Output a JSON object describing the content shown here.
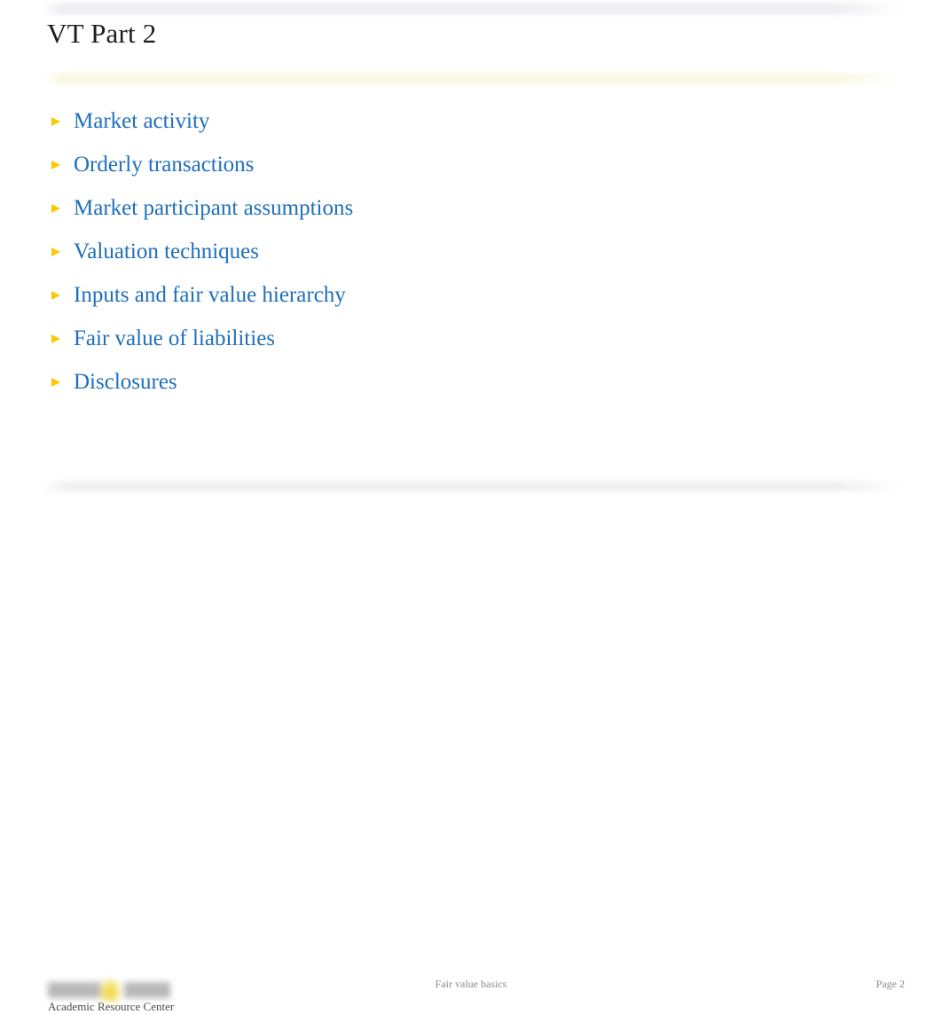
{
  "slide": {
    "title": "VT Part 2",
    "bullets": [
      {
        "marker": "triangle-right-bullet-icon",
        "label": "Market activity"
      },
      {
        "marker": "triangle-right-bullet-icon",
        "label": "Orderly transactions"
      },
      {
        "marker": "triangle-right-bullet-icon",
        "label": "Market participant assumptions"
      },
      {
        "marker": "triangle-right-bullet-icon",
        "label": "Valuation techniques"
      },
      {
        "marker": "triangle-right-bullet-icon",
        "label": "Inputs and fair value hierarchy"
      },
      {
        "marker": "triangle-right-bullet-icon",
        "label": "Fair value of liabilities"
      },
      {
        "marker": "triangle-right-bullet-icon",
        "label": "Disclosures"
      }
    ]
  },
  "footer": {
    "organization": "Academic Resource Center",
    "deck_title": "Fair value basics",
    "page_label": "Page 2",
    "logo_name": "academic-resource-center-logo"
  },
  "colors": {
    "bullet_marker": "#fcc800",
    "bullet_text": "#1e6fbc",
    "title_text": "#1d1d1d",
    "divider_band": "#f9f7e2",
    "top_band": "#eeeef1",
    "footer_text": "#8a8a8a",
    "org_text": "#4a4a4a",
    "background": "#ffffff"
  }
}
